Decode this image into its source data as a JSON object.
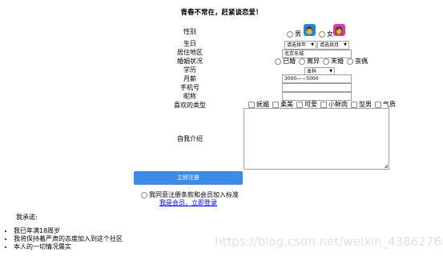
{
  "page": {
    "title": "青春不常在，赶紧谈恋爱！"
  },
  "form": {
    "gender": {
      "label": "性别",
      "options": [
        "男",
        "女"
      ],
      "male_icon_glyph": "👨",
      "female_icon_glyph": "👩"
    },
    "birthday": {
      "label": "生日",
      "year_value": "请选择年",
      "month_value": "请选择月"
    },
    "region": {
      "label": "居住地区",
      "value": "北京东城"
    },
    "marital": {
      "label": "婚姻状况",
      "options": [
        "已婚",
        "离异",
        "未婚",
        "丧偶"
      ]
    },
    "education": {
      "label": "学历",
      "value": "本科"
    },
    "salary": {
      "label": "月薪",
      "value": "3000——5000"
    },
    "phone": {
      "label": "手机号",
      "value": ""
    },
    "nickname": {
      "label": "昵称",
      "value": ""
    },
    "preferred_type": {
      "label": "喜欢的类型",
      "options": [
        "妩媚",
        "柔美",
        "可爱",
        "小鲜肉",
        "型男",
        "气质"
      ]
    },
    "intro": {
      "label": "自我介绍",
      "value": ""
    },
    "register_button": "立即注册",
    "agree_text": "我同意注册条款和会员加入标准",
    "login_link": "我是会员，立即登录"
  },
  "promise": {
    "heading": "我承诺:",
    "items": [
      "我已年满18周岁",
      "我将保持着严肃的态度加入到这个社区",
      "本人的一切情况属实"
    ]
  },
  "watermark": "https://blog.csdn.net/weixin_43862765",
  "colors": {
    "accent": "#3c8ce6",
    "male_icon": "#1a8ad8",
    "female_icon": "#e03aa8",
    "link": "#0000ee"
  }
}
